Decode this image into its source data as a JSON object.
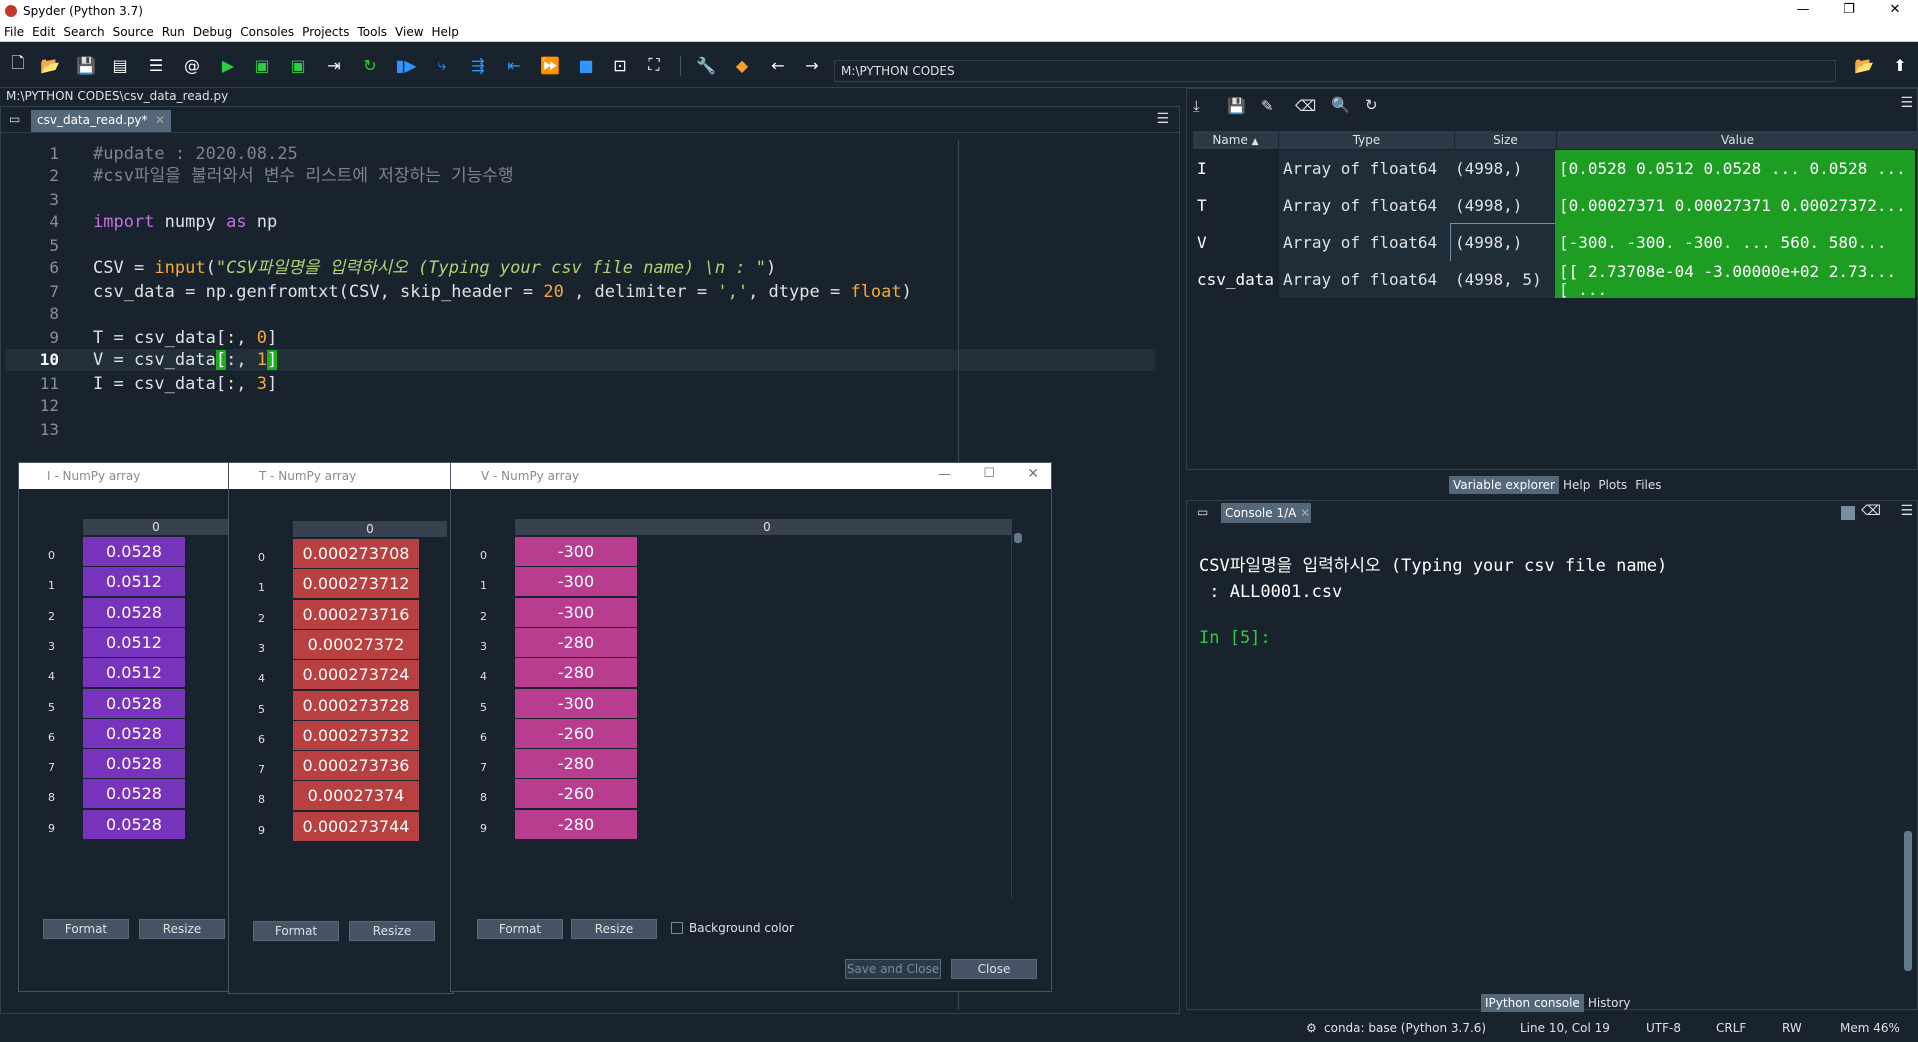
{
  "window": {
    "title": "Spyder (Python 3.7)"
  },
  "menu": [
    "File",
    "Edit",
    "Search",
    "Source",
    "Run",
    "Debug",
    "Consoles",
    "Projects",
    "Tools",
    "View",
    "Help"
  ],
  "toolbar": {
    "path": "M:\\PYTHON CODES"
  },
  "editor": {
    "file_path": "M:\\PYTHON CODES\\csv_data_read.py",
    "tab_label": "csv_data_read.py*",
    "lines": [
      {
        "n": "1"
      },
      {
        "n": "2"
      },
      {
        "n": "3"
      },
      {
        "n": "4"
      },
      {
        "n": "5"
      },
      {
        "n": "6"
      },
      {
        "n": "7"
      },
      {
        "n": "8"
      },
      {
        "n": "9"
      },
      {
        "n": "10"
      },
      {
        "n": "11"
      },
      {
        "n": "12"
      },
      {
        "n": "13"
      }
    ],
    "code": {
      "l1": "#update : 2020.08.25",
      "l2": "#csv파일을 불러와서 변수 리스트에 저장하는 기능수행",
      "l4_kw1": "import",
      "l4_mod": " numpy ",
      "l4_kw2": "as",
      "l4_alias": " np",
      "l6_a": "CSV = ",
      "l6_fn": "input",
      "l6_b": "(",
      "l6_str": "\"CSV파일명을 입력하시오 (Typing your csv file name) \\n : \"",
      "l6_c": ")",
      "l7_a": "csv_data = np.genfromtxt(CSV, skip_header = ",
      "l7_num": "20",
      "l7_b": " , delimiter = ",
      "l7_str": "','",
      "l7_c": ", dtype = ",
      "l7_type": "float",
      "l7_d": ")",
      "l9_a": "T = csv_data[:, ",
      "l9_num": "0",
      "l9_b": "]",
      "l10_a": "V = csv_data",
      "l10_br1": "[",
      "l10_b": ":, ",
      "l10_num": "1",
      "l10_br2": "]",
      "l11_a": "I = csv_data[:, ",
      "l11_num": "3",
      "l11_b": "]"
    }
  },
  "dialogs": {
    "I": {
      "title": "I - NumPy array",
      "col": "0",
      "rows": [
        "0",
        "1",
        "2",
        "3",
        "4",
        "5",
        "6",
        "7",
        "8",
        "9"
      ],
      "values": [
        "0.0528",
        "0.0512",
        "0.0528",
        "0.0512",
        "0.0512",
        "0.0528",
        "0.0528",
        "0.0528",
        "0.0528",
        "0.0528"
      ],
      "format": "Format",
      "resize": "Resize"
    },
    "T": {
      "title": "T - NumPy array",
      "col": "0",
      "rows": [
        "0",
        "1",
        "2",
        "3",
        "4",
        "5",
        "6",
        "7",
        "8",
        "9"
      ],
      "values": [
        "0.000273708",
        "0.000273712",
        "0.000273716",
        "0.00027372",
        "0.000273724",
        "0.000273728",
        "0.000273732",
        "0.000273736",
        "0.00027374",
        "0.000273744"
      ],
      "format": "Format",
      "resize": "Resize"
    },
    "V": {
      "title": "V - NumPy array",
      "col": "0",
      "rows": [
        "0",
        "1",
        "2",
        "3",
        "4",
        "5",
        "6",
        "7",
        "8",
        "9"
      ],
      "values": [
        "-300",
        "-300",
        "-300",
        "-280",
        "-280",
        "-300",
        "-260",
        "-280",
        "-260",
        "-280"
      ],
      "format": "Format",
      "resize": "Resize",
      "bg_color": "Background color",
      "save_close": "Save and Close",
      "close": "Close"
    }
  },
  "variable_explorer": {
    "headers": {
      "name": "Name",
      "type": "Type",
      "size": "Size",
      "value": "Value"
    },
    "rows": [
      {
        "name": "I",
        "type": "Array of float64",
        "size": "(4998,)",
        "value": "[0.0528 0.0512 0.0528 ... 0.0528 ..."
      },
      {
        "name": "T",
        "type": "Array of float64",
        "size": "(4998,)",
        "value": "[0.00027371 0.00027371 0.00027372..."
      },
      {
        "name": "V",
        "type": "Array of float64",
        "size": "(4998,)",
        "value": "[-300. -300. -300. ...  560.  580..."
      },
      {
        "name": "csv_data",
        "type": "Array of float64",
        "size": "(4998, 5)",
        "value": "[[ 2.73708e-04 -3.00000e+02  2.73..."
      }
    ],
    "value_line2": "[ ...",
    "tabs": [
      "Variable explorer",
      "Help",
      "Plots",
      "Files"
    ]
  },
  "console": {
    "tab": "Console 1/A",
    "line1": "CSV파일명을 입력하시오 (Typing your csv file name)",
    "line2": " : ALL0001.csv",
    "prompt": "In [5]:",
    "tabs": [
      "IPython console",
      "History"
    ]
  },
  "status": {
    "conda": "conda: base (Python 3.7.6)",
    "pos": "Line 10, Col 19",
    "enc": "UTF-8",
    "eol": "CRLF",
    "rw": "RW",
    "mem": "Mem 46%"
  }
}
